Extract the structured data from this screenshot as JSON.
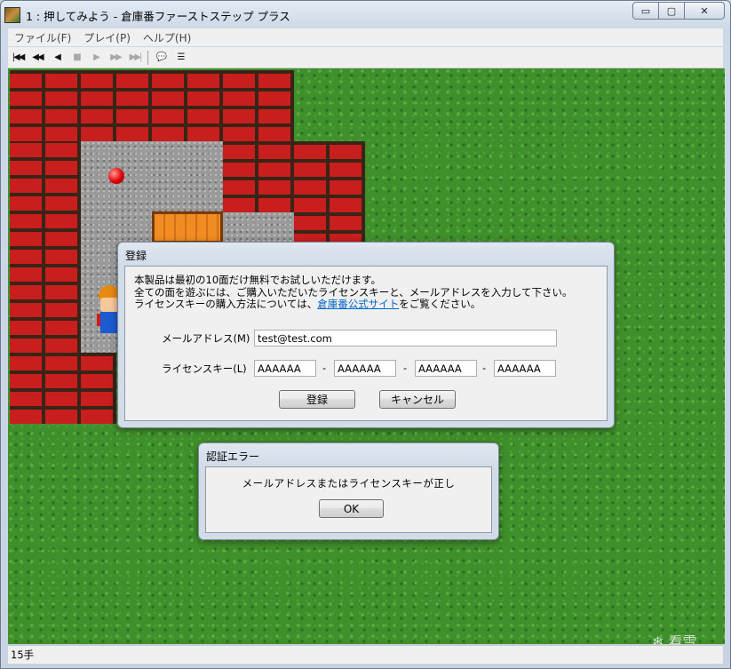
{
  "window": {
    "title": "1 : 押してみよう - 倉庫番ファーストステップ プラス",
    "buttons": {
      "minimize": "▭",
      "maximize": "▢",
      "close": "✕"
    }
  },
  "menu": [
    {
      "label": "ファイル(F)"
    },
    {
      "label": "プレイ(P)"
    },
    {
      "label": "ヘルプ(H)"
    }
  ],
  "toolbar": {
    "first": "|◀◀",
    "prev_fast": "◀◀",
    "prev": "◀",
    "stop": "■",
    "next": "▶",
    "next_fast": "▶▶",
    "last": "▶▶|",
    "comment": "💬",
    "list": "☰"
  },
  "register_dialog": {
    "title": "登録",
    "desc_line1": "本製品は最初の10面だけ無料でお試しいただけます。",
    "desc_line2": "全ての面を遊ぶには、ご購入いただいたライセンスキーと、メールアドレスを入力して下さい。",
    "desc_line3_pre": "ライセンスキーの購入方法については、",
    "desc_link": "倉庫番公式サイト",
    "desc_line3_post": "をご覧ください。",
    "email_label": "メールアドレス(M)",
    "email_value": "test@test.com",
    "license_label": "ライセンスキー(L)",
    "license_parts": [
      "AAAAAA",
      "AAAAAA",
      "AAAAAA",
      "AAAAAA"
    ],
    "separator": "-",
    "register_button": "登録",
    "cancel_button": "キャンセル"
  },
  "error_dialog": {
    "title": "認証エラー",
    "message": "メールアドレスまたはライセンスキーが正し",
    "ok_button": "OK"
  },
  "status": {
    "moves": "15手"
  },
  "watermark": "❄ 看雪",
  "colors": {
    "grass": "#3f8f2c",
    "brick": "#c81e1e",
    "link": "#0066cc"
  }
}
